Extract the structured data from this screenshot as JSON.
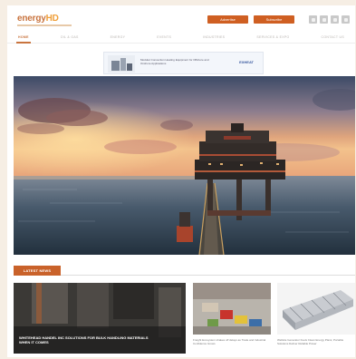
{
  "header": {
    "logo_part1": "energy",
    "logo_part2": "HD",
    "buttons": [
      "Advertise",
      "Subscribe"
    ],
    "social_icons": [
      "facebook-icon",
      "twitter-icon",
      "linkedin-icon",
      "rss-icon"
    ]
  },
  "nav": {
    "items": [
      "HOME",
      "OIL & GAS",
      "ENERGY",
      "EVENTS",
      "INDUSTRIES",
      "SERVICES & EXPO",
      "CONTACT US"
    ],
    "active_index": 0
  },
  "ad": {
    "text": "Modular Convection Heating Equipment for Offshore and Onshore Applications",
    "brand": "EXHEAT"
  },
  "hero": {
    "image": "offshore-oil-platform-sunset"
  },
  "latest_news": {
    "label": "LATEST NEWS",
    "cards": [
      {
        "title": "WHITEHEAD HANDEL INC SOLUTIONS FOR BULK HANDLING MATERIALS WHEN IT COMES"
      },
      {
        "title": "Freight Ecosystem shakes off delays as Trade and Industrial Confidence Grows"
      },
      {
        "title": "Wellsite Generator Fuels Clean Energy Plans; Portable Solutions Deliver Reliable Power"
      }
    ]
  },
  "colors": {
    "accent": "#c9622a",
    "logo_orange": "#f0a03a",
    "page_bg": "#f6eee4"
  }
}
